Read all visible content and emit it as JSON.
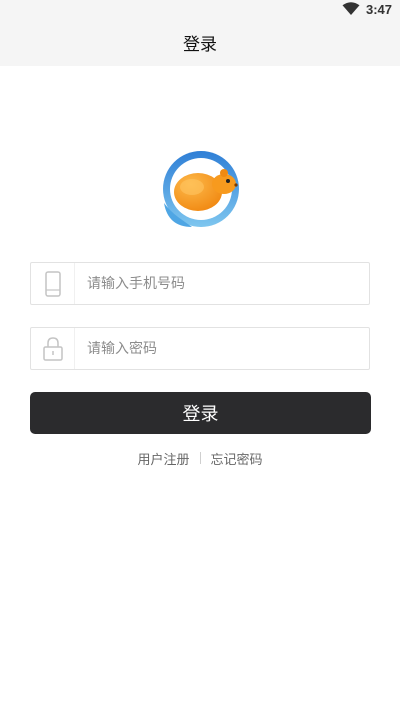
{
  "status_bar": {
    "time": "3:47",
    "wifi_icon": "wifi-icon"
  },
  "header": {
    "title": "登录"
  },
  "logo": {
    "icon": "hamster-logo",
    "colors": {
      "ring_blue": "#2f7fd6",
      "ring_light": "#7ec6ef",
      "body_orange": "#f79a1e"
    }
  },
  "form": {
    "phone": {
      "icon": "phone-icon",
      "placeholder": "请输入手机号码",
      "value": ""
    },
    "password": {
      "icon": "lock-icon",
      "placeholder": "请输入密码",
      "value": ""
    },
    "login_label": "登录"
  },
  "links": {
    "register": "用户注册",
    "forgot_password": "忘记密码"
  },
  "colors": {
    "button_bg": "#2b2b2d",
    "header_bg": "#f5f5f5"
  }
}
